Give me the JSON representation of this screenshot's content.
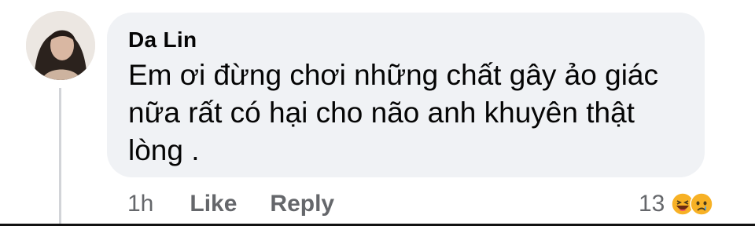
{
  "comment": {
    "author": "Da Lin",
    "text_lines": [
      "Em ơi đừng chơi những chất gây ảo giác",
      "nữa rất có hại cho não anh khuyên thật",
      "lòng ."
    ],
    "time": "1h",
    "like_label": "Like",
    "reply_label": "Reply",
    "reaction_count": "13",
    "reactions": [
      "haha-emoji-icon",
      "sad-emoji-icon"
    ]
  },
  "colors": {
    "bubble_bg": "#f0f2f5",
    "text": "#050505",
    "meta": "#65676b",
    "emoji_yellow": "#f7b125"
  }
}
